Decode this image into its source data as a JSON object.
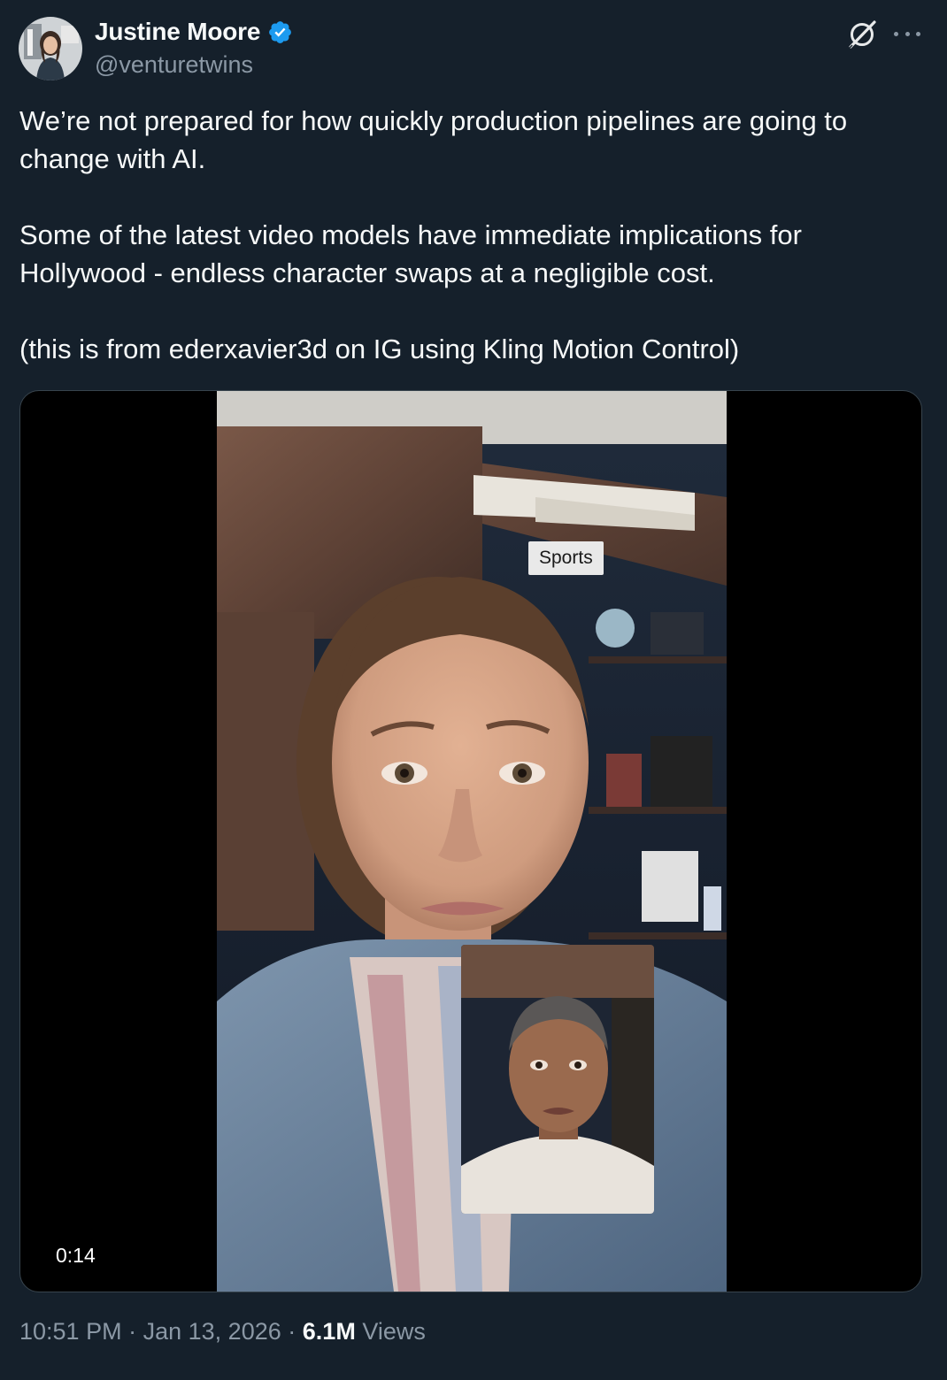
{
  "author": {
    "display_name": "Justine Moore",
    "handle": "@venturetwins",
    "verified": true,
    "avatar_icon": "profile-photo"
  },
  "header_icons": [
    "grok-icon",
    "more-options-icon"
  ],
  "tweet": {
    "paragraphs": [
      "We’re not prepared for how quickly production pipelines are going to change with AI.",
      "Some of the latest video models have immediate implications for Hollywood - endless character swaps at a negligible cost.",
      "(this is from ederxavier3d on IG using Kling Motion Control)"
    ]
  },
  "media": {
    "type": "video",
    "overlay_label": "Sports",
    "duration": "0:14"
  },
  "meta": {
    "time": "10:51 PM",
    "separator": "·",
    "date": "Jan 13, 2026",
    "views_count": "6.1M",
    "views_label": "Views"
  },
  "colors": {
    "background": "#15202b",
    "text_primary": "#f7f9f9",
    "text_secondary": "#8b98a5",
    "verified_badge": "#1d9bf0",
    "border": "#38444d"
  }
}
